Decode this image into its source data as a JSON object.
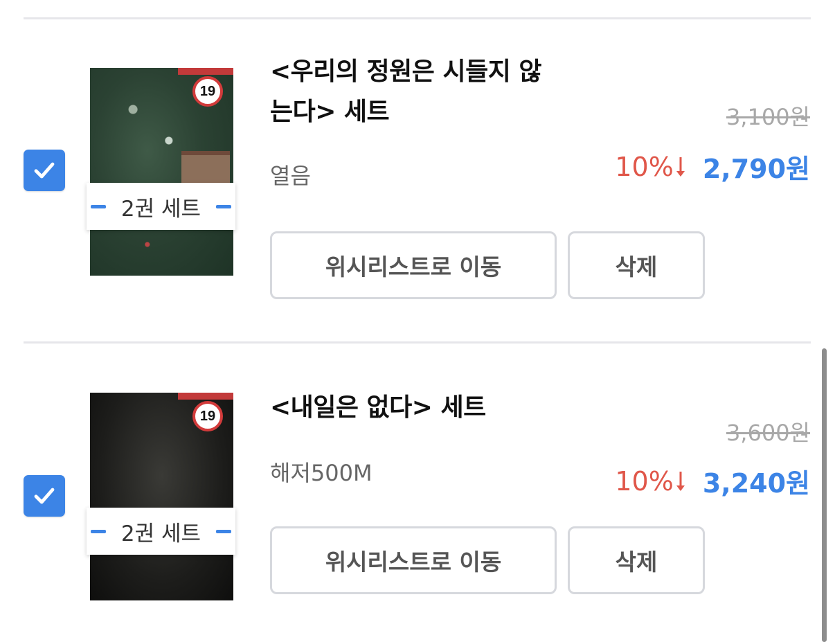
{
  "items": [
    {
      "title_line1": "<우리의 정원은 시들지 않",
      "title_line2": "는다> 세트",
      "publisher": "열음",
      "set_label": "2권 세트",
      "age_rating": "19",
      "original_price": "3,100원",
      "discount": "10%",
      "sale_price": "2,790원",
      "wishlist_button": "위시리스트로 이동",
      "delete_button": "삭제",
      "checked": true
    },
    {
      "title_line1": "<내일은 없다> 세트",
      "publisher": "해저500M",
      "set_label": "2권 세트",
      "age_rating": "19",
      "original_price": "3,600원",
      "discount": "10%",
      "sale_price": "3,240원",
      "wishlist_button": "위시리스트로 이동",
      "delete_button": "삭제",
      "checked": true
    }
  ],
  "colors": {
    "accent_blue": "#3c84e6",
    "discount_red": "#e0574a",
    "strike_gray": "#a8a8a8",
    "divider": "#e6e6ea"
  },
  "icons": [
    "checkmark-icon",
    "down-arrow-icon"
  ]
}
